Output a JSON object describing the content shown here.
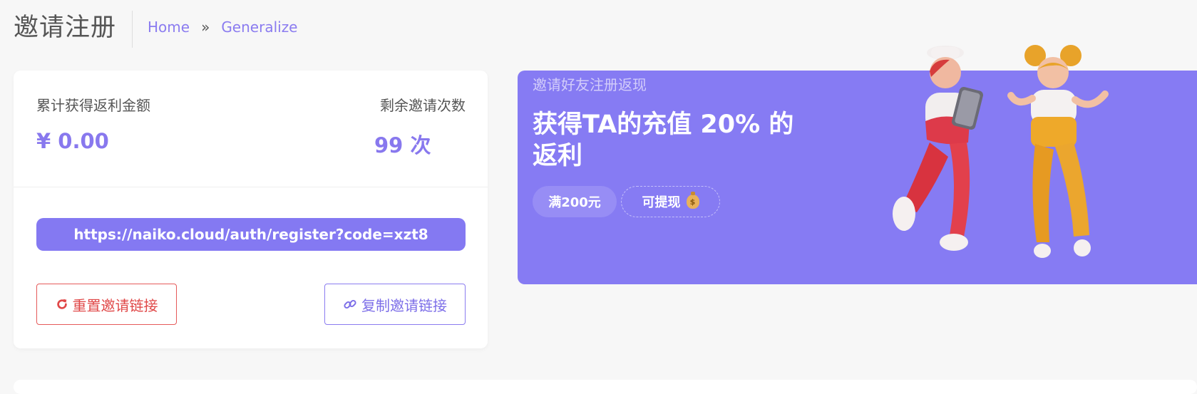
{
  "header": {
    "title": "邀请注册",
    "breadcrumb": {
      "home": "Home",
      "separator": "»",
      "current": "Generalize"
    }
  },
  "stats": {
    "rebate_label": "累计获得返利金额",
    "rebate_value": "¥ 0.00",
    "invites_label": "剩余邀请次数",
    "invites_value": "99 次"
  },
  "invite_link": "https://naiko.cloud/auth/register?code=xzt8",
  "buttons": {
    "reset_label": "重置邀请链接",
    "reset_icon": "refresh-icon",
    "copy_label": "复制邀请链接",
    "copy_icon": "link-icon"
  },
  "banner": {
    "subtitle": "邀请好友注册返现",
    "title": "获得TA的充值 20% 的返利",
    "pill_min": "满200元",
    "pill_withdraw": "可提现",
    "pill_withdraw_icon": "money-bag-icon",
    "illustration": "two-jumping-people-illustration"
  },
  "colors": {
    "accent": "#867bf3",
    "danger": "#e04848",
    "background": "#f7f7f7"
  }
}
